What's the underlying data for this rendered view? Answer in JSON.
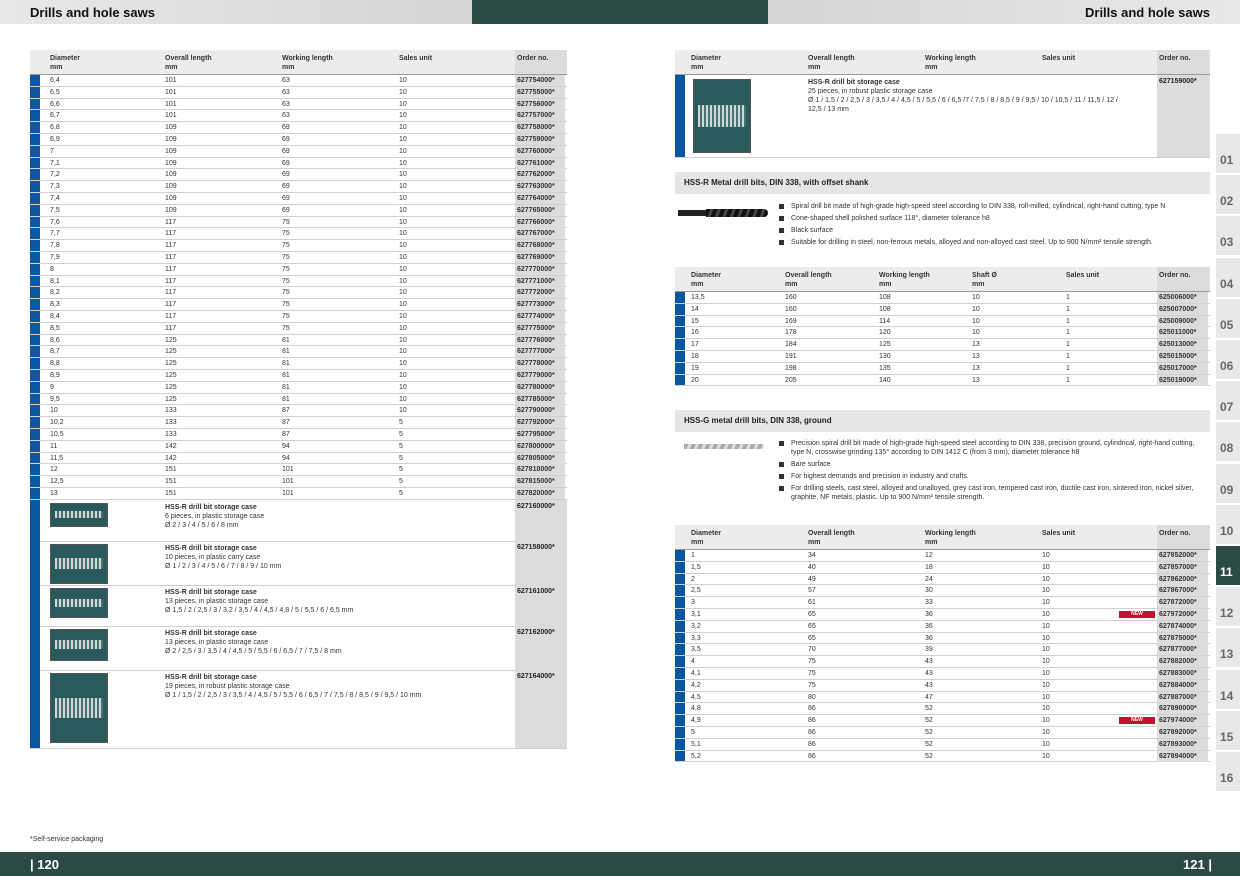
{
  "header": {
    "left_title": "Drills and hole saws",
    "right_title": "Drills and hole saws"
  },
  "footer": {
    "left_page": "| 120",
    "right_page": "121 |",
    "footnote": "*Self-service packaging"
  },
  "left_table": {
    "headers": [
      "Diameter\nmm",
      "Overall length\nmm",
      "Working length\nmm",
      "Sales unit",
      "Order no."
    ],
    "rows": [
      [
        "6,4",
        "101",
        "63",
        "10",
        "627754000*"
      ],
      [
        "6,5",
        "101",
        "63",
        "10",
        "627755000*"
      ],
      [
        "6,6",
        "101",
        "63",
        "10",
        "627756000*"
      ],
      [
        "6,7",
        "101",
        "63",
        "10",
        "627757000*"
      ],
      [
        "6,8",
        "109",
        "69",
        "10",
        "627758000*"
      ],
      [
        "6,9",
        "109",
        "69",
        "10",
        "627759000*"
      ],
      [
        "7",
        "109",
        "69",
        "10",
        "627760000*"
      ],
      [
        "7,1",
        "109",
        "69",
        "10",
        "627761000*"
      ],
      [
        "7,2",
        "109",
        "69",
        "10",
        "627762000*"
      ],
      [
        "7,3",
        "109",
        "69",
        "10",
        "627763000*"
      ],
      [
        "7,4",
        "109",
        "69",
        "10",
        "627764000*"
      ],
      [
        "7,5",
        "109",
        "69",
        "10",
        "627765000*"
      ],
      [
        "7,6",
        "117",
        "75",
        "10",
        "627766000*"
      ],
      [
        "7,7",
        "117",
        "75",
        "10",
        "627767000*"
      ],
      [
        "7,8",
        "117",
        "75",
        "10",
        "627768000*"
      ],
      [
        "7,9",
        "117",
        "75",
        "10",
        "627769000*"
      ],
      [
        "8",
        "117",
        "75",
        "10",
        "627770000*"
      ],
      [
        "8,1",
        "117",
        "75",
        "10",
        "627771000*"
      ],
      [
        "8,2",
        "117",
        "75",
        "10",
        "627772000*"
      ],
      [
        "8,3",
        "117",
        "75",
        "10",
        "627773000*"
      ],
      [
        "8,4",
        "117",
        "75",
        "10",
        "627774000*"
      ],
      [
        "8,5",
        "117",
        "75",
        "10",
        "627775000*"
      ],
      [
        "8,6",
        "125",
        "81",
        "10",
        "627776000*"
      ],
      [
        "8,7",
        "125",
        "81",
        "10",
        "627777000*"
      ],
      [
        "8,8",
        "125",
        "81",
        "10",
        "627778000*"
      ],
      [
        "8,9",
        "125",
        "81",
        "10",
        "627779000*"
      ],
      [
        "9",
        "125",
        "81",
        "10",
        "627780000*"
      ],
      [
        "9,5",
        "125",
        "81",
        "10",
        "627785000*"
      ],
      [
        "10",
        "133",
        "87",
        "10",
        "627790000*"
      ],
      [
        "10,2",
        "133",
        "87",
        "5",
        "627792000*"
      ],
      [
        "10,5",
        "133",
        "87",
        "5",
        "627795000*"
      ],
      [
        "11",
        "142",
        "94",
        "5",
        "627800000*"
      ],
      [
        "11,5",
        "142",
        "94",
        "5",
        "627805000*"
      ],
      [
        "12",
        "151",
        "101",
        "5",
        "627810000*"
      ],
      [
        "12,5",
        "151",
        "101",
        "5",
        "627815000*"
      ],
      [
        "13",
        "151",
        "101",
        "5",
        "627820000*"
      ]
    ],
    "cases": [
      {
        "title": "HSS-R drill bit storage case",
        "line1": "6 pieces, in plastic storage case",
        "line2": "Ø 2 / 3 / 4 / 5 / 6 / 8 mm",
        "order": "627160000*"
      },
      {
        "title": "HSS-R drill bit storage case",
        "line1": "10 pieces, in plastic carry case",
        "line2": "Ø 1 / 2 / 3 / 4 / 5 / 6 / 7 / 8 / 9 / 10 mm",
        "order": "627158000*"
      },
      {
        "title": "HSS-R drill bit storage case",
        "line1": "13 pieces, in plastic storage case",
        "line2": "Ø 1,5 / 2 / 2,5 / 3 / 3,2 / 3,5 / 4 / 4,5 / 4,8 / 5 / 5,5 / 6 / 6,5 mm",
        "order": "627161000*"
      },
      {
        "title": "HSS-R drill bit storage case",
        "line1": "13 pieces, in plastic storage case",
        "line2": "Ø 2 / 2,5 / 3 / 3,5 / 4 / 4,5 / 5 / 5,5 / 6 / 6,5 / 7 / 7,5 / 8 mm",
        "order": "627162000*"
      },
      {
        "title": "HSS-R drill bit storage case",
        "line1": "19 pieces, in robust plastic storage case",
        "line2": "Ø 1 / 1,5 / 2 / 2,5 / 3 / 3,5 / 4 / 4,5 / 5 / 5,5 / 6 / 6,5 / 7 / 7,5 / 8 / 8,5 / 9 / 9,5 / 10 mm",
        "order": "627164000*"
      }
    ]
  },
  "right_top": {
    "headers": [
      "Diameter\nmm",
      "Overall length\nmm",
      "Working length\nmm",
      "Sales unit",
      "Order no."
    ],
    "case": {
      "title": "HSS-R drill bit storage case",
      "line1": "25 pieces, in robust plastic storage case",
      "line2": "Ø 1 / 1,5 / 2 / 2,5 / 3 / 3,5 / 4 / 4,5 / 5 / 5,5 / 6 / 6,5 /7 / 7,5 / 8 / 8,5 / 9 / 9,5 / 10 / 10,5 / 11 / 11,5 / 12 /",
      "line3": "12,5 / 13 mm",
      "order": "627159000*"
    }
  },
  "section2": {
    "title": "HSS-R Metal drill bits, DIN 338, with offset shank",
    "bullets": [
      "Spiral drill bit made of high-grade high-speed steel according to DIN 338, roll-milled, cylindrical, right-hand cutting, type N",
      "Cone-shaped shell polished surface 118°, diameter tolerance h8",
      "Black surface",
      "Suitable for drilling in steel, non-ferrous metals, alloyed and non-alloyed cast steel. Up to 900 N/mm² tensile strength."
    ],
    "headers": [
      "Diameter\nmm",
      "Overall length\nmm",
      "Working length\nmm",
      "Shaft Ø\nmm",
      "Sales unit",
      "Order no."
    ],
    "rows": [
      [
        "13,5",
        "160",
        "108",
        "10",
        "1",
        "625006000*"
      ],
      [
        "14",
        "160",
        "108",
        "10",
        "1",
        "625007000*"
      ],
      [
        "15",
        "169",
        "114",
        "10",
        "1",
        "625009000*"
      ],
      [
        "16",
        "178",
        "120",
        "10",
        "1",
        "625011000*"
      ],
      [
        "17",
        "184",
        "125",
        "13",
        "1",
        "625013000*"
      ],
      [
        "18",
        "191",
        "130",
        "13",
        "1",
        "625015000*"
      ],
      [
        "19",
        "198",
        "135",
        "13",
        "1",
        "625017000*"
      ],
      [
        "20",
        "205",
        "140",
        "13",
        "1",
        "625019000*"
      ]
    ]
  },
  "section3": {
    "title": "HSS-G metal drill bits, DIN 338, ground",
    "bullets": [
      "Precision spiral drill bit made of high-grade high-speed steel according to DIN 338, precision ground, cylindrical, right-hand cutting, type N, crosswise grinding 135° according to DIN 1412 C (from 3 mm), diameter tolerance h8",
      "Bare surface",
      "For highest demands and precision in industry and crafts.",
      "For drilling steels, cast steel, alloyed and unalloyed, grey cast iron, tempered cast iron, ductile cast iron, sintered iron, nickel silver, graphite, NF metals, plastic. Up to 900 N/mm² tensile strength."
    ],
    "headers": [
      "Diameter\nmm",
      "Overall length\nmm",
      "Working length\nmm",
      "Sales unit",
      "Order no."
    ],
    "new_label": "NEW",
    "rows": [
      [
        "1",
        "34",
        "12",
        "10",
        "627852000*",
        ""
      ],
      [
        "1,5",
        "40",
        "18",
        "10",
        "627857000*",
        ""
      ],
      [
        "2",
        "49",
        "24",
        "10",
        "627862000*",
        ""
      ],
      [
        "2,5",
        "57",
        "30",
        "10",
        "627867000*",
        ""
      ],
      [
        "3",
        "61",
        "33",
        "10",
        "627872000*",
        ""
      ],
      [
        "3,1",
        "65",
        "36",
        "10",
        "627972000*",
        "NEW"
      ],
      [
        "3,2",
        "65",
        "36",
        "10",
        "627874000*",
        ""
      ],
      [
        "3,3",
        "65",
        "36",
        "10",
        "627875000*",
        ""
      ],
      [
        "3,5",
        "70",
        "39",
        "10",
        "627877000*",
        ""
      ],
      [
        "4",
        "75",
        "43",
        "10",
        "627882000*",
        ""
      ],
      [
        "4,1",
        "75",
        "43",
        "10",
        "627883000*",
        ""
      ],
      [
        "4,2",
        "75",
        "43",
        "10",
        "627884000*",
        ""
      ],
      [
        "4,5",
        "80",
        "47",
        "10",
        "627887000*",
        ""
      ],
      [
        "4,8",
        "86",
        "52",
        "10",
        "627890000*",
        ""
      ],
      [
        "4,9",
        "86",
        "52",
        "10",
        "627974000*",
        "NEW"
      ],
      [
        "5",
        "86",
        "52",
        "10",
        "627892000*",
        ""
      ],
      [
        "5,1",
        "86",
        "52",
        "10",
        "627893000*",
        ""
      ],
      [
        "5,2",
        "86",
        "52",
        "10",
        "627894000*",
        ""
      ]
    ]
  },
  "tabs": {
    "items": [
      "01",
      "02",
      "03",
      "04",
      "05",
      "06",
      "07",
      "08",
      "09",
      "10",
      "11",
      "12",
      "13",
      "14",
      "15",
      "16"
    ],
    "active": "11"
  },
  "colors": {
    "accent_blue": "#0a56a0",
    "dark_green": "#2c4a44",
    "new_red": "#c8102e"
  }
}
